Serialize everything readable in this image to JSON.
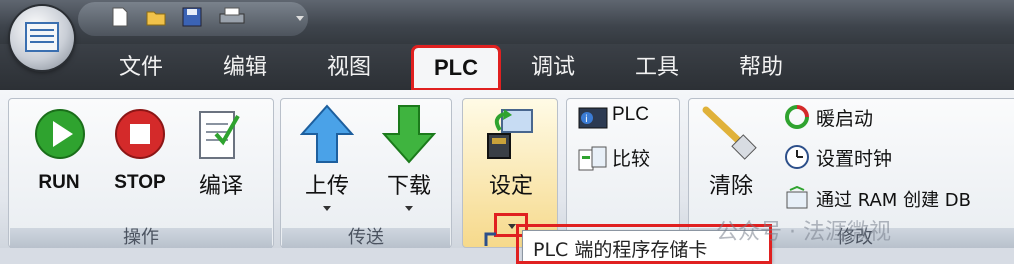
{
  "menu_tabs": [
    "文件",
    "编辑",
    "视图",
    "PLC",
    "调试",
    "工具",
    "帮助"
  ],
  "active_tab": "PLC",
  "groups": {
    "operation": {
      "label": "操作",
      "buttons": [
        "RUN",
        "STOP",
        "编译"
      ]
    },
    "transfer": {
      "label": "传送",
      "buttons": [
        "上传",
        "下载"
      ]
    },
    "settings": {
      "label": "设定"
    },
    "compare": {
      "items": [
        "PLC",
        "比较"
      ]
    },
    "modify": {
      "label": "修改",
      "items": [
        "清除",
        "暖启动",
        "设置时钟",
        "通过 RAM 创建 DB"
      ]
    }
  },
  "tooltip": "PLC 端的程序存储卡",
  "watermark": "公众号 · 法涯微视",
  "colors": {
    "highlight": "#e02020",
    "run": "#2fa32f",
    "stop": "#d42a2a"
  }
}
